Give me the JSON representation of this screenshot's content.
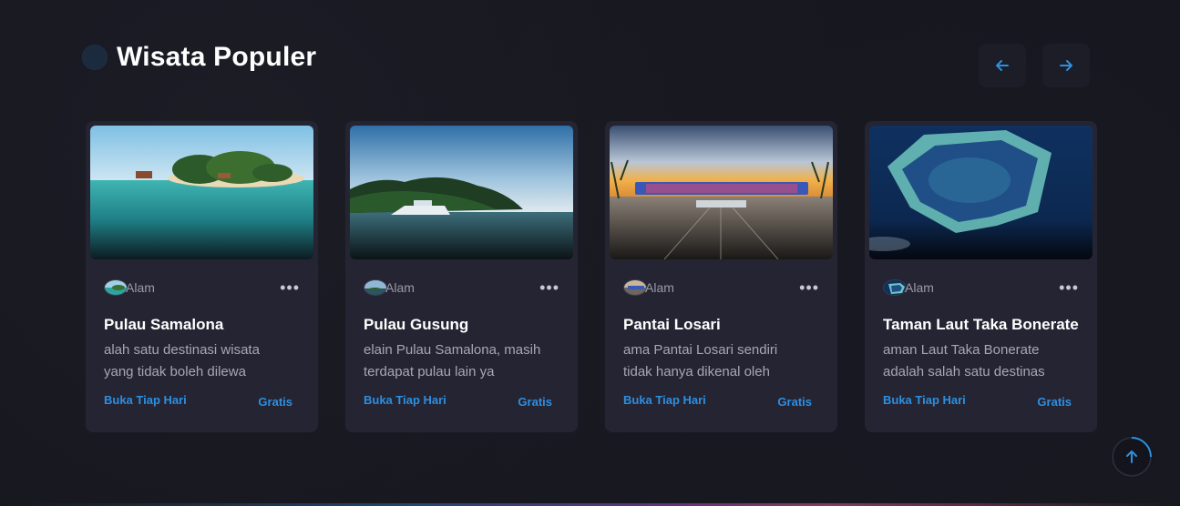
{
  "section": {
    "title": "Wisata Populer"
  },
  "colors": {
    "background": "#16161d",
    "card": "#252433",
    "accent": "#2d8fe0",
    "title": "#ffffff",
    "muted": "#a7a7b4"
  },
  "icons": {
    "prev": "arrow-left-icon",
    "next": "arrow-right-icon",
    "more": "more-horizontal-icon",
    "scroll_top": "arrow-up-icon"
  },
  "cards": [
    {
      "category": "Alam",
      "title": "Pulau Samalona",
      "description": "alah satu destinasi wisata yang tidak boleh dilewa",
      "hours": "Buka Tiap Hari",
      "price": "Gratis"
    },
    {
      "category": "Alam",
      "title": "Pulau Gusung",
      "description": "elain Pulau Samalona, masih terdapat pulau lain ya",
      "hours": "Buka Tiap Hari",
      "price": "Gratis"
    },
    {
      "category": "Alam",
      "title": "Pantai Losari",
      "description": "ama Pantai Losari sendiri tidak hanya dikenal oleh",
      "hours": "Buka Tiap Hari",
      "price": "Gratis"
    },
    {
      "category": "Alam",
      "title": "Taman Laut Taka Bonerate",
      "description": "aman Laut Taka Bonerate adalah salah satu destinas",
      "hours": "Buka Tiap Hari",
      "price": "Gratis"
    }
  ]
}
